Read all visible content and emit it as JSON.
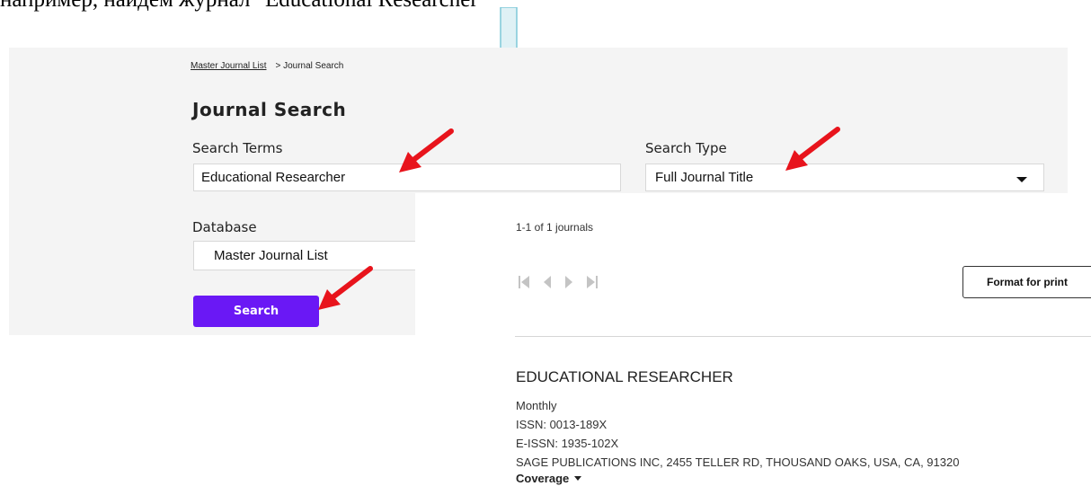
{
  "caption": "например, найдем журнал \"Educational Researcher\"",
  "breadcrumb": {
    "link": "Master Journal List",
    "current": "> Journal Search"
  },
  "page_title": "Journal Search",
  "search_terms": {
    "label": "Search Terms",
    "value": "Educational Researcher"
  },
  "search_type": {
    "label": "Search Type",
    "value": "Full Journal Title"
  },
  "database": {
    "label": "Database",
    "value": "Master Journal List"
  },
  "search_button": "Search",
  "results": {
    "count_text": "1-1 of 1 journals",
    "format_print": "Format for print",
    "journal": {
      "title": "EDUCATIONAL RESEARCHER",
      "frequency": "Monthly",
      "issn": "ISSN: 0013-189X",
      "eissn": "E-ISSN: 1935-102X",
      "publisher": "SAGE PUBLICATIONS INC, 2455 TELLER RD, THOUSAND OAKS, USA, CA, 91320",
      "coverage": "Coverage"
    }
  },
  "colors": {
    "search_button": "#6a18f5",
    "annotation_arrow": "#e8141c",
    "down_arrow_fill": "#dff1f5",
    "down_arrow_stroke": "#7ec8d8"
  },
  "icons": [
    "first-page-icon",
    "prev-page-icon",
    "next-page-icon",
    "last-page-icon",
    "dropdown-caret-icon"
  ]
}
